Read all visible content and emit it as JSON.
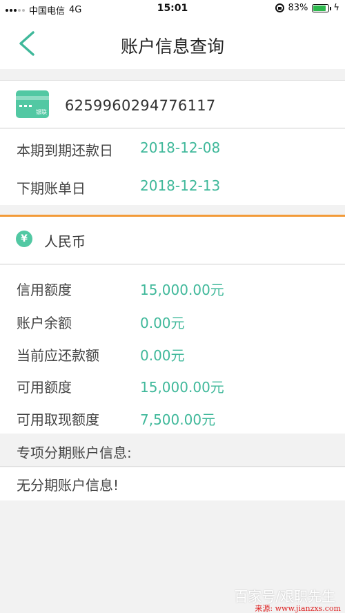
{
  "status_bar": {
    "carrier": "中国电信",
    "network": "4G",
    "time": "15:01",
    "battery": "83%",
    "battery_level": 0.83
  },
  "nav": {
    "title": "账户信息查询"
  },
  "card": {
    "brand": "银联",
    "number": "6259960294776117"
  },
  "dates": [
    {
      "label": "本期到期还款日",
      "value": "2018-12-08"
    },
    {
      "label": "下期账单日",
      "value": "2018-12-13"
    }
  ],
  "currency": {
    "symbol": "¥",
    "label": "人民币"
  },
  "credit": [
    {
      "label": "信用额度",
      "value": "15,000.00元"
    },
    {
      "label": "账户余额",
      "value": "0.00元"
    },
    {
      "label": "当前应还款额",
      "value": "0.00元"
    },
    {
      "label": "可用额度",
      "value": "15,000.00元"
    },
    {
      "label": "可用取现额度",
      "value": "7,500.00元"
    }
  ],
  "installment": {
    "header": "专项分期账户信息:",
    "message": "无分期账户信息!"
  },
  "watermark": {
    "text": "百家号/艰职先生",
    "source": "来源: www.jianzxs.com"
  },
  "colors": {
    "accent": "#3fb89a",
    "divider": "#f29a38"
  }
}
